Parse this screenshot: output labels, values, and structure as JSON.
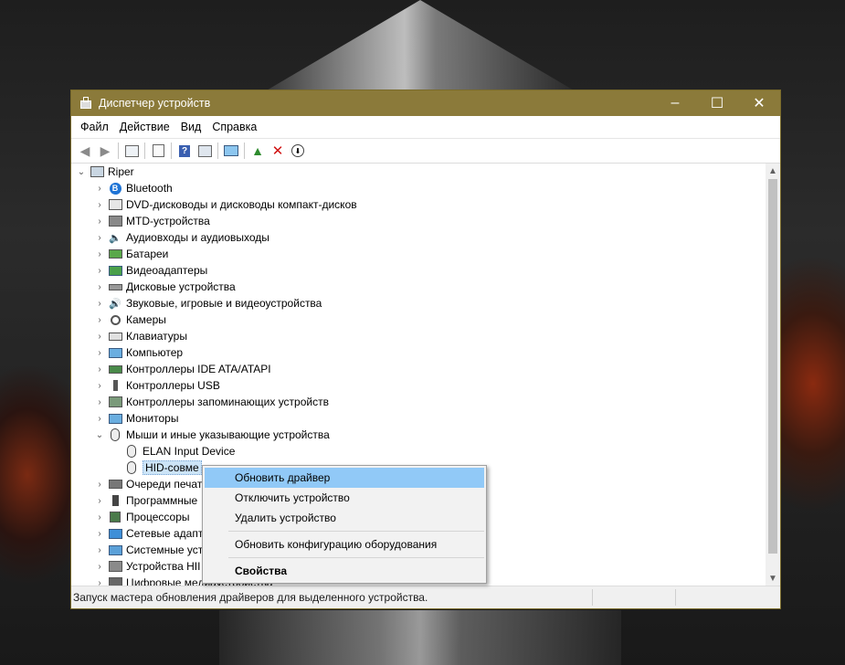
{
  "window": {
    "title": "Диспетчер устройств",
    "accent_color": "#8b7a3a",
    "controls": [
      "–",
      "☐",
      "✕"
    ]
  },
  "menubar": [
    "Файл",
    "Действие",
    "Вид",
    "Справка"
  ],
  "toolbar_icons": [
    "back-icon",
    "forward-icon",
    "properties-pane-icon",
    "list-icon",
    "help-icon",
    "view-icon",
    "monitor-scan-icon",
    "update-driver-icon",
    "uninstall-icon",
    "download-icon"
  ],
  "tree": {
    "root": "Riper",
    "items": [
      {
        "label": "Bluetooth",
        "icon": "bluetooth-icon"
      },
      {
        "label": "DVD-дисководы и дисководы компакт-дисков",
        "icon": "dvd-icon"
      },
      {
        "label": "MTD-устройства",
        "icon": "mtd-icon"
      },
      {
        "label": "Аудиовходы и аудиовыходы",
        "icon": "speaker-icon"
      },
      {
        "label": "Батареи",
        "icon": "battery-icon"
      },
      {
        "label": "Видеоадаптеры",
        "icon": "display-adapter-icon"
      },
      {
        "label": "Дисковые устройства",
        "icon": "disk-icon"
      },
      {
        "label": "Звуковые, игровые и видеоустройства",
        "icon": "sound-icon"
      },
      {
        "label": "Камеры",
        "icon": "camera-icon"
      },
      {
        "label": "Клавиатуры",
        "icon": "keyboard-icon"
      },
      {
        "label": "Компьютер",
        "icon": "computer-icon"
      },
      {
        "label": "Контроллеры IDE ATA/ATAPI",
        "icon": "ide-icon"
      },
      {
        "label": "Контроллеры USB",
        "icon": "usb-icon"
      },
      {
        "label": "Контроллеры запоминающих устройств",
        "icon": "storage-controller-icon"
      },
      {
        "label": "Мониторы",
        "icon": "monitor-icon"
      },
      {
        "label": "Мыши и иные указывающие устройства",
        "icon": "mouse-icon",
        "expanded": true,
        "children": [
          "ELAN Input Device",
          "HID-совме"
        ]
      },
      {
        "label": "Очереди печат",
        "icon": "printer-icon"
      },
      {
        "label": "Программные",
        "icon": "software-device-icon"
      },
      {
        "label": "Процессоры",
        "icon": "processor-icon"
      },
      {
        "label": "Сетевые адапт",
        "icon": "network-icon"
      },
      {
        "label": "Системные уст",
        "icon": "system-icon"
      },
      {
        "label": "Устройства HII",
        "icon": "hid-icon"
      },
      {
        "label": "Цифровые медиаустройства",
        "icon": "media-icon"
      }
    ]
  },
  "context_menu": {
    "items": [
      "Обновить драйвер",
      "Отключить устройство",
      "Удалить устройство",
      "Обновить конфигурацию оборудования",
      "Свойства"
    ]
  },
  "statusbar": {
    "text": "Запуск мастера обновления драйверов для выделенного устройства.",
    "color": "#1a1a1a"
  }
}
